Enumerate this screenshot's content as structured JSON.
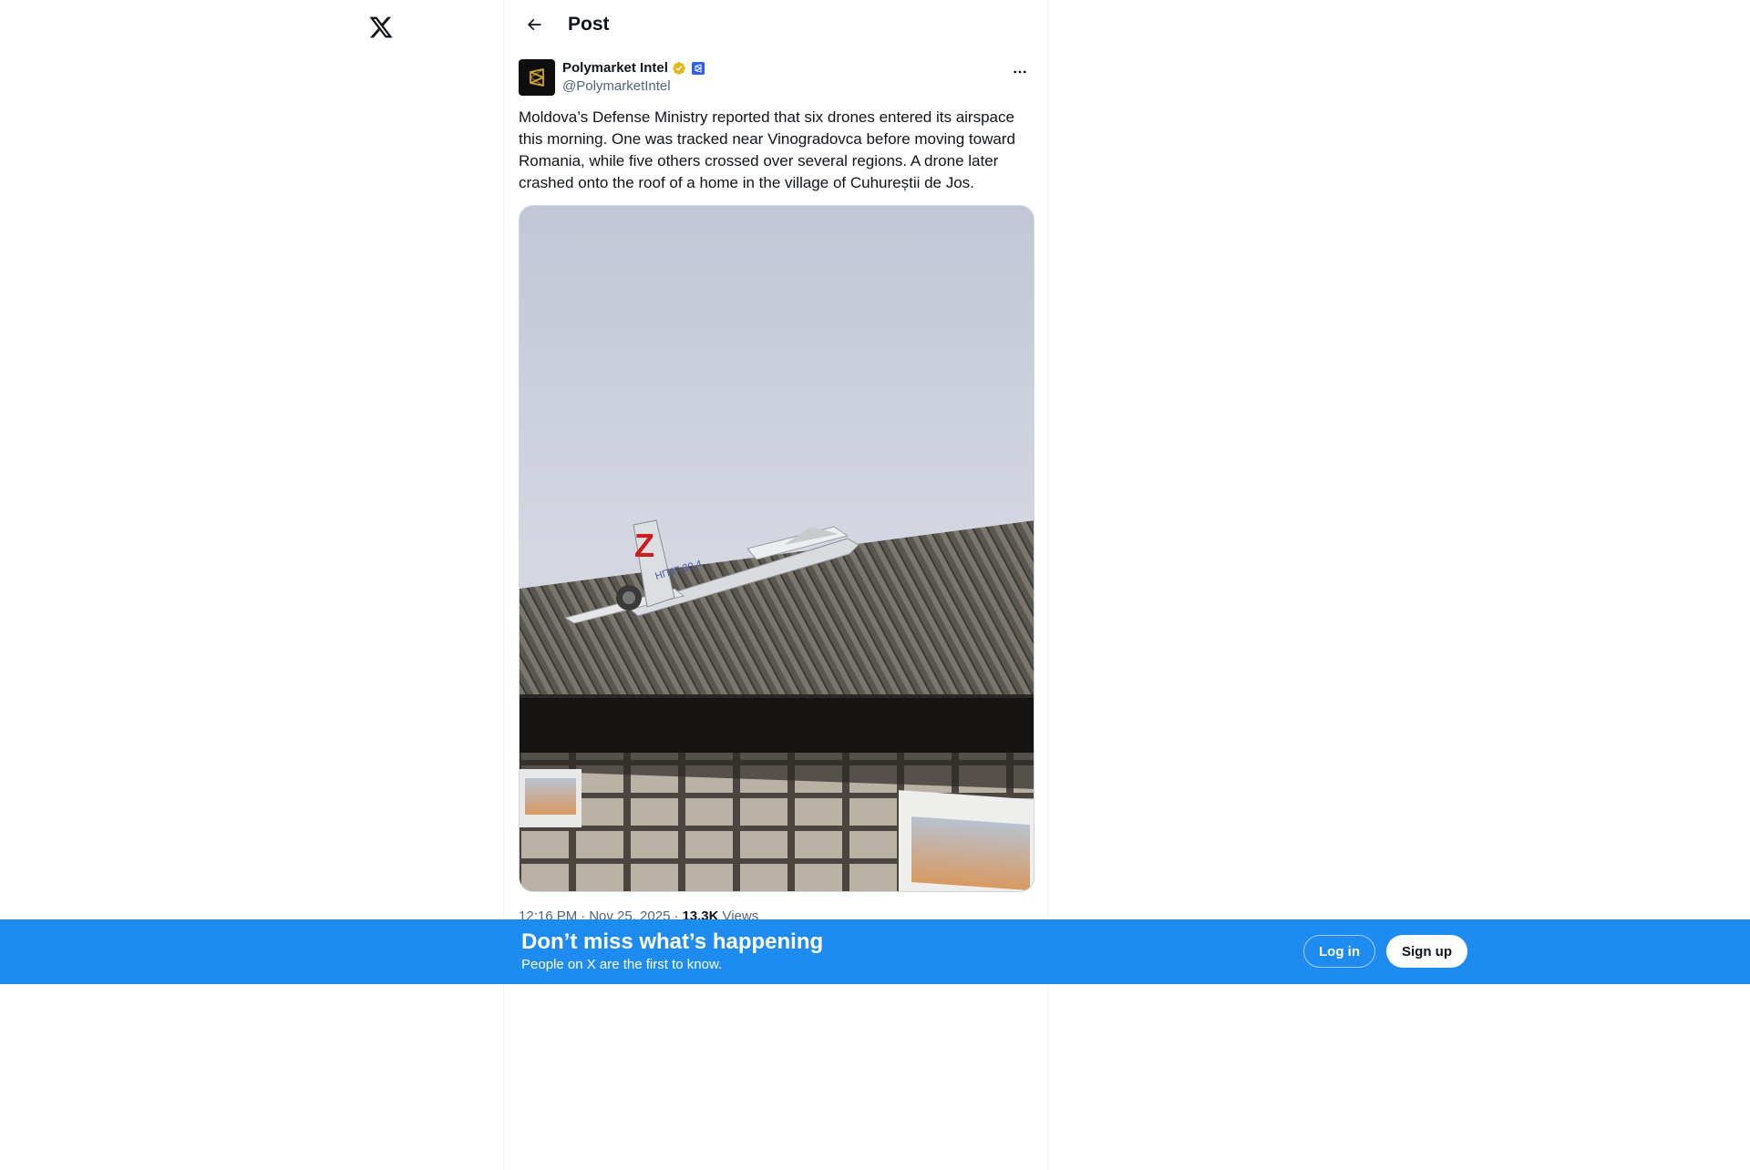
{
  "nav": {
    "logo_icon": "x-logo-icon"
  },
  "header": {
    "title": "Post",
    "back_icon": "arrow-left-icon"
  },
  "post": {
    "author": {
      "display_name": "Polymarket Intel",
      "handle": "@PolymarketIntel",
      "verified_badge_color": "#e2b719",
      "affiliate_badge_color": "#2e5cff"
    },
    "more_icon": "more-options-icon",
    "text": "Moldova’s Defense Ministry reported that six drones entered its airspace this morning. One was tracked near Vinogradovca before moving toward Romania, while five others crossed over several regions. A drone later crashed onto the roof of a home in the village of Cuhureștii de Jos.",
    "media": {
      "drone_marking": "Z",
      "drone_serial": "НП47 30 4"
    },
    "meta": {
      "time": "12:16 PM",
      "date": "Nov 25, 2025",
      "separator": "·",
      "views_count": "13.3K",
      "views_label": "Views"
    }
  },
  "banner": {
    "title": "Don’t miss what’s happening",
    "subtitle": "People on X are the first to know.",
    "login_label": "Log in",
    "signup_label": "Sign up",
    "background_color": "#1d8bf0"
  }
}
